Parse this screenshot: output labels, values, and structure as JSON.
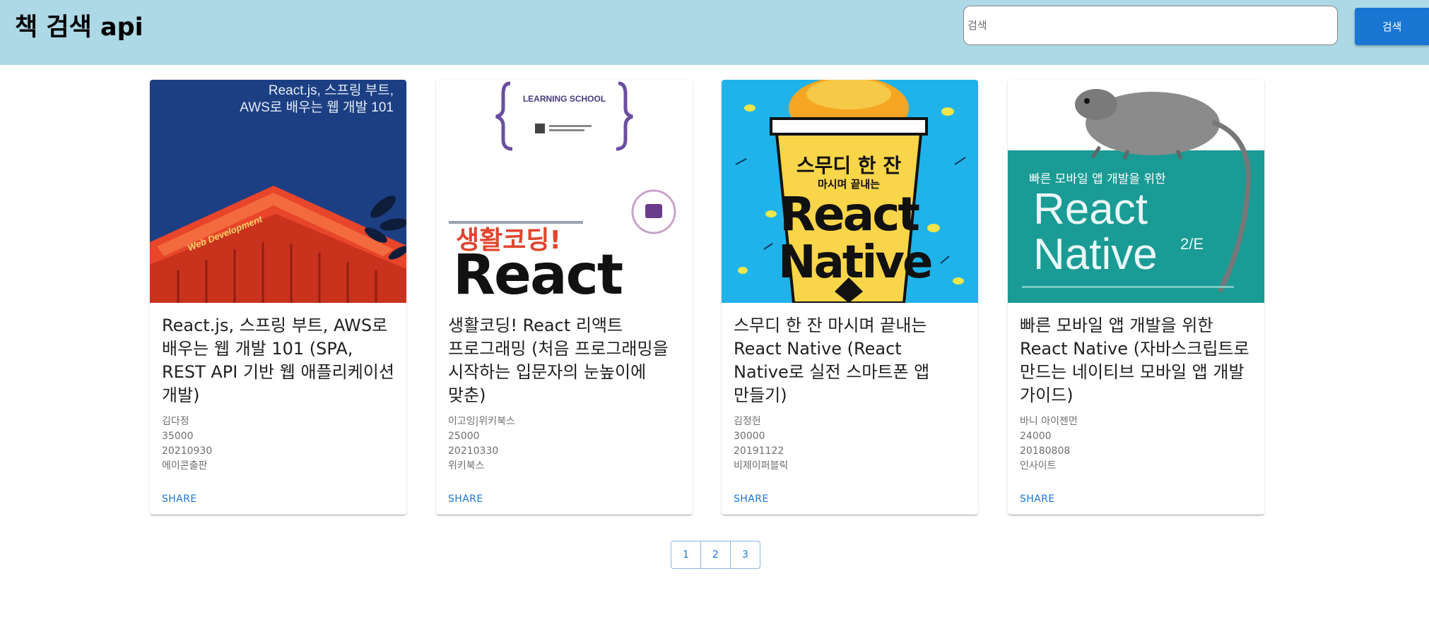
{
  "header": {
    "title": "책 검색 api",
    "search_placeholder": "검색",
    "search_value": "",
    "search_button": "검색"
  },
  "books": [
    {
      "cover_text_lines": [
        "React.js, 스프링 부트,",
        "AWS로 배우는 웹 개발 101"
      ],
      "cover_caption": "Web Development",
      "title": "React.js, 스프링 부트, AWS로 배우는 웹 개발 101 (SPA, REST API 기반 웹 애플리케이션 개발)",
      "author": "김다정",
      "price": "35000",
      "date": "20210930",
      "publisher": "에이콘출판",
      "share": "SHARE"
    },
    {
      "cover_badge": "LEARNING SCHOOL",
      "cover_text_lines": [
        "생활코딩!",
        "React"
      ],
      "title": "생활코딩! React 리액트 프로그래밍 (처음 프로그래밍을 시작하는 입문자의 눈높이에 맞춘)",
      "author": "이고잉|위키북스",
      "price": "25000",
      "date": "20210330",
      "publisher": "위키북스",
      "share": "SHARE"
    },
    {
      "cover_text_lines": [
        "스무디 한 잔",
        "마시며 끝내는",
        "React",
        "Native"
      ],
      "title": "스무디 한 잔 마시며 끝내는 React Native (React Native로 실전 스마트폰 앱 만들기)",
      "author": "김정헌",
      "price": "30000",
      "date": "20191122",
      "publisher": "비제이퍼블릭",
      "share": "SHARE"
    },
    {
      "cover_text_lines": [
        "빠른 모바일 앱 개발을 위한",
        "React",
        "Native",
        "2/E"
      ],
      "title": "빠른 모바일 앱 개발을 위한 React Native (자바스크립트로 만드는 네이티브 모바일 앱 개발 가이드)",
      "author": "바니 아이젠먼",
      "price": "24000",
      "date": "20180808",
      "publisher": "인사이트",
      "share": "SHARE"
    }
  ],
  "pagination": {
    "pages": [
      "1",
      "2",
      "3"
    ]
  }
}
